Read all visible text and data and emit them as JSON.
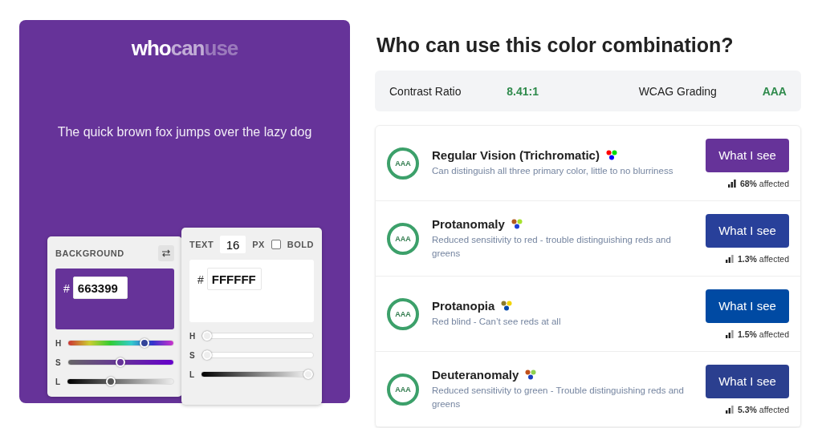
{
  "preview": {
    "logo": [
      "who",
      "can",
      "use"
    ],
    "sample": "The quick brown fox jumps over the lazy dog"
  },
  "background_panel": {
    "label": "BACKGROUND",
    "hash": "#",
    "value": "663399",
    "sliders": [
      {
        "label": "H",
        "level": 0.75
      },
      {
        "label": "S",
        "level": 0.5
      },
      {
        "label": "L",
        "level": 0.4
      }
    ]
  },
  "text_panel": {
    "label": "TEXT",
    "size": "16",
    "unit": "PX",
    "bold": {
      "label": "BOLD",
      "checked": false
    },
    "hash": "#",
    "value": "FFFFFF",
    "sliders": [
      {
        "label": "H",
        "level": 0
      },
      {
        "label": "S",
        "level": 0
      },
      {
        "label": "L",
        "level": 1
      }
    ]
  },
  "title": "Who can use this color combination?",
  "stats": [
    {
      "label": "Contrast Ratio",
      "value": "8.41:1"
    },
    {
      "label": "WCAG Grading",
      "value": "AAA"
    }
  ],
  "visions": [
    {
      "grade": "AAA",
      "name": "Regular Vision (Trichromatic)",
      "dots": [
        {
          "color": "#ff0000"
        },
        {
          "color": "#00dd00"
        },
        {
          "color": "#0000ff"
        }
      ],
      "description": "Can distinguish all three primary color, little to no blurriness",
      "button": {
        "label": "What I see",
        "color": "#663399"
      },
      "percent": "68%",
      "affected": "affected"
    },
    {
      "grade": "AAA",
      "name": "Protanomaly",
      "dots": [
        {
          "color": "#b35a1f"
        },
        {
          "color": "#a6e22e"
        },
        {
          "color": "#1d3fd8"
        }
      ],
      "description": "Reduced sensitivity to red - trouble distinguishing reds and greens",
      "button": {
        "label": "What I see",
        "color": "#28409a"
      },
      "percent": "1.3%",
      "affected": "affected"
    },
    {
      "grade": "AAA",
      "name": "Protanopia",
      "dots": [
        {
          "color": "#8c7a2a"
        },
        {
          "color": "#f2d400"
        },
        {
          "color": "#0047ab"
        }
      ],
      "description": "Red blind - Can’t see reds at all",
      "button": {
        "label": "What I see",
        "color": "#004aa3"
      },
      "percent": "1.5%",
      "affected": "affected"
    },
    {
      "grade": "AAA",
      "name": "Deuteranomaly",
      "dots": [
        {
          "color": "#c0501a"
        },
        {
          "color": "#8fd14f"
        },
        {
          "color": "#1a3fc0"
        }
      ],
      "description": "Reduced sensitivity to green - Trouble distinguishing reds and greens",
      "button": {
        "label": "What I see",
        "color": "#2b3f8f"
      },
      "percent": "5.3%",
      "affected": "affected"
    }
  ]
}
